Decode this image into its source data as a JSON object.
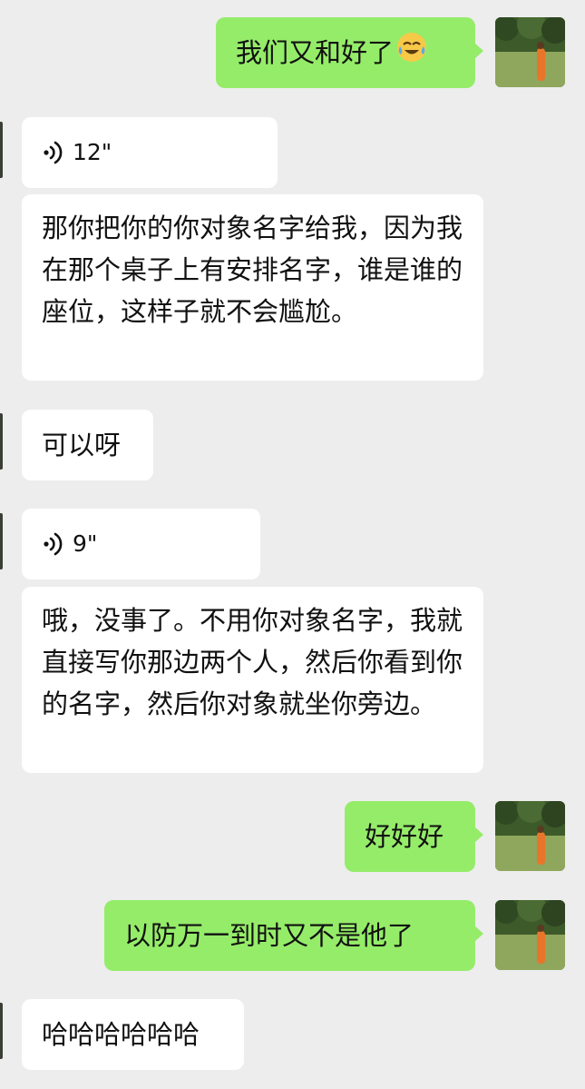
{
  "messages": [
    {
      "id": "m1",
      "side": "out",
      "kind": "text",
      "text": "我们又和好了",
      "emoji": "face-with-tears-of-joy-icon"
    },
    {
      "id": "m2",
      "side": "in",
      "kind": "voice",
      "duration": "12\""
    },
    {
      "id": "m3",
      "side": "in",
      "kind": "text",
      "text": "那你把你的你对象名字给我，因为我在那个桌子上有安排名字，谁是谁的座位，这样子就不会尴尬。"
    },
    {
      "id": "m4",
      "side": "in",
      "kind": "text",
      "text": "可以呀"
    },
    {
      "id": "m5",
      "side": "in",
      "kind": "voice",
      "duration": "9\""
    },
    {
      "id": "m6",
      "side": "in",
      "kind": "text",
      "text": "哦，没事了。不用你对象名字，我就直接写你那边两个人，然后你看到你的名字，然后你对象就坐你旁边。"
    },
    {
      "id": "m7",
      "side": "out",
      "kind": "text",
      "text": "好好好"
    },
    {
      "id": "m8",
      "side": "out",
      "kind": "text",
      "text": "以防万一到时又不是他了"
    },
    {
      "id": "m9",
      "side": "in",
      "kind": "text",
      "text": "哈哈哈哈哈哈"
    }
  ],
  "colors": {
    "background": "#ededed",
    "outgoing_bubble": "#95ec69",
    "incoming_bubble": "#ffffff",
    "text": "#111111"
  }
}
